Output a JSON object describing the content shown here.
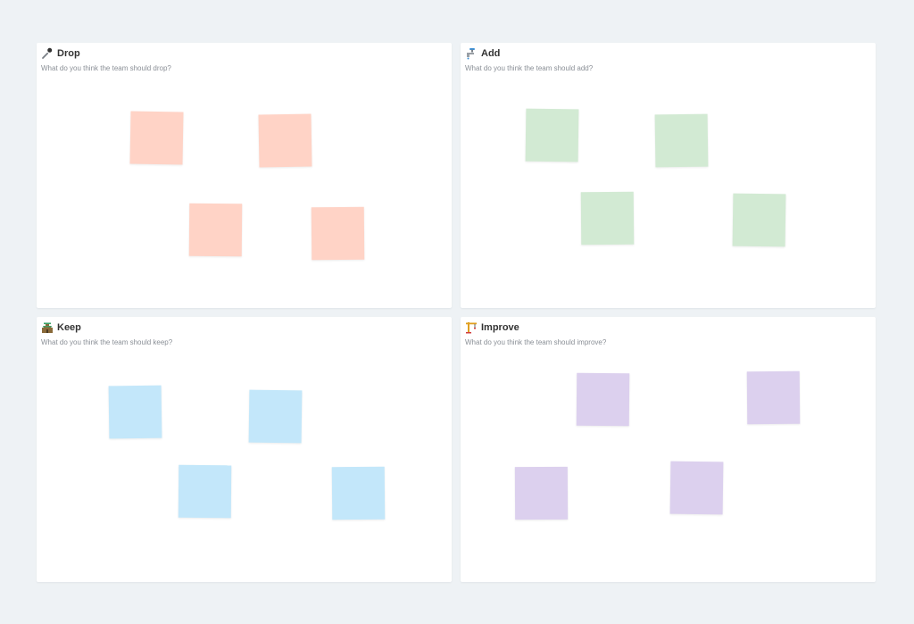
{
  "panels": {
    "drop": {
      "title": "Drop",
      "subtitle": "What do you think the team should drop?",
      "icon": "microphone-icon",
      "sticky_color": "#ffd3c6"
    },
    "add": {
      "title": "Add",
      "subtitle": "What do you think the team should add?",
      "icon": "faucet-icon",
      "sticky_color": "#d2ead3"
    },
    "keep": {
      "title": "Keep",
      "subtitle": "What do you think the team should keep?",
      "icon": "castle-icon",
      "sticky_color": "#c3e7fa"
    },
    "improve": {
      "title": "Improve",
      "subtitle": "What do you think the team should improve?",
      "icon": "crane-icon",
      "sticky_color": "#dcd0ee"
    }
  },
  "colors": {
    "background": "#eef2f5",
    "panel": "#ffffff"
  }
}
